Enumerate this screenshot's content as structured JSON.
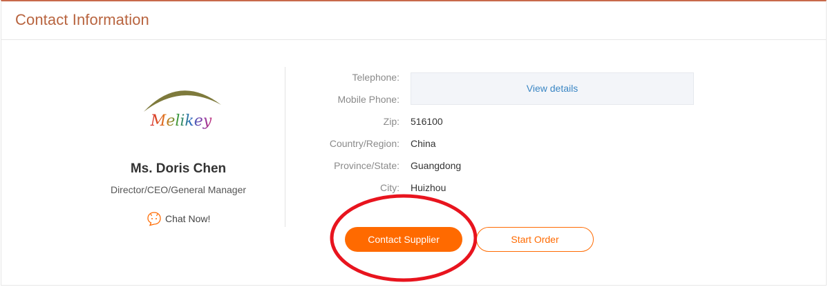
{
  "header": {
    "title": "Contact Information"
  },
  "profile": {
    "logo_text": "Melikey",
    "name": "Ms. Doris Chen",
    "title": "Director/CEO/General Manager",
    "chat_label": "Chat Now!"
  },
  "contact": {
    "telephone_label": "Telephone:",
    "mobile_label": "Mobile Phone:",
    "view_details_label": "View details",
    "fields": [
      {
        "label": "Zip:",
        "value": "516100"
      },
      {
        "label": "Country/Region:",
        "value": "China"
      },
      {
        "label": "Province/State:",
        "value": "Guangdong"
      },
      {
        "label": "City:",
        "value": "Huizhou"
      }
    ]
  },
  "actions": {
    "contact_supplier": "Contact Supplier",
    "start_order": "Start Order"
  },
  "colors": {
    "accent": "#ff6a00",
    "header_title": "#b8643f",
    "link": "#3a86c4",
    "highlight_circle": "#e8141e"
  }
}
